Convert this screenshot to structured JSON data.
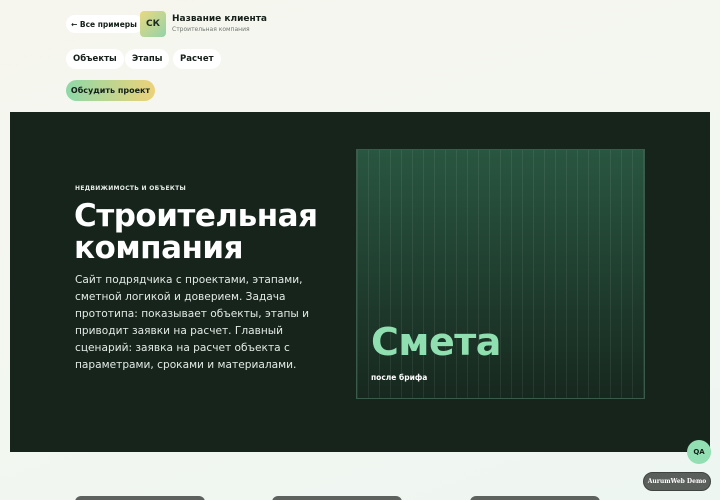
{
  "header": {
    "back_label": "← Все примеры",
    "logo_text": "СК",
    "client_name": "Название клиента",
    "client_subtitle": "Строительная компания"
  },
  "nav": [
    {
      "label": "Объекты"
    },
    {
      "label": "Этапы"
    },
    {
      "label": "Расчет"
    }
  ],
  "cta_label": "Обсудить проект",
  "hero": {
    "eyebrow": "НЕДВИЖИМОСТЬ И ОБЪЕКТЫ",
    "title": "Строительная компания",
    "description": "Сайт подрядчика с проектами, этапами, сметной логикой и доверием. Задача прототипа: показывает объекты, этапы и приводит заявки на расчет. Главный сценарий: заявка на расчет объекта с параметрами, сроками и материалами.",
    "visual_word": "Смета",
    "visual_caption": "после брифа"
  },
  "floating": {
    "qa_label": "QA",
    "demo_badge": "AurumWeb Demo"
  },
  "colors": {
    "hero_bg": "#16241c",
    "accent_green": "#90dfb0",
    "accent_gold": "#ecd27a"
  }
}
